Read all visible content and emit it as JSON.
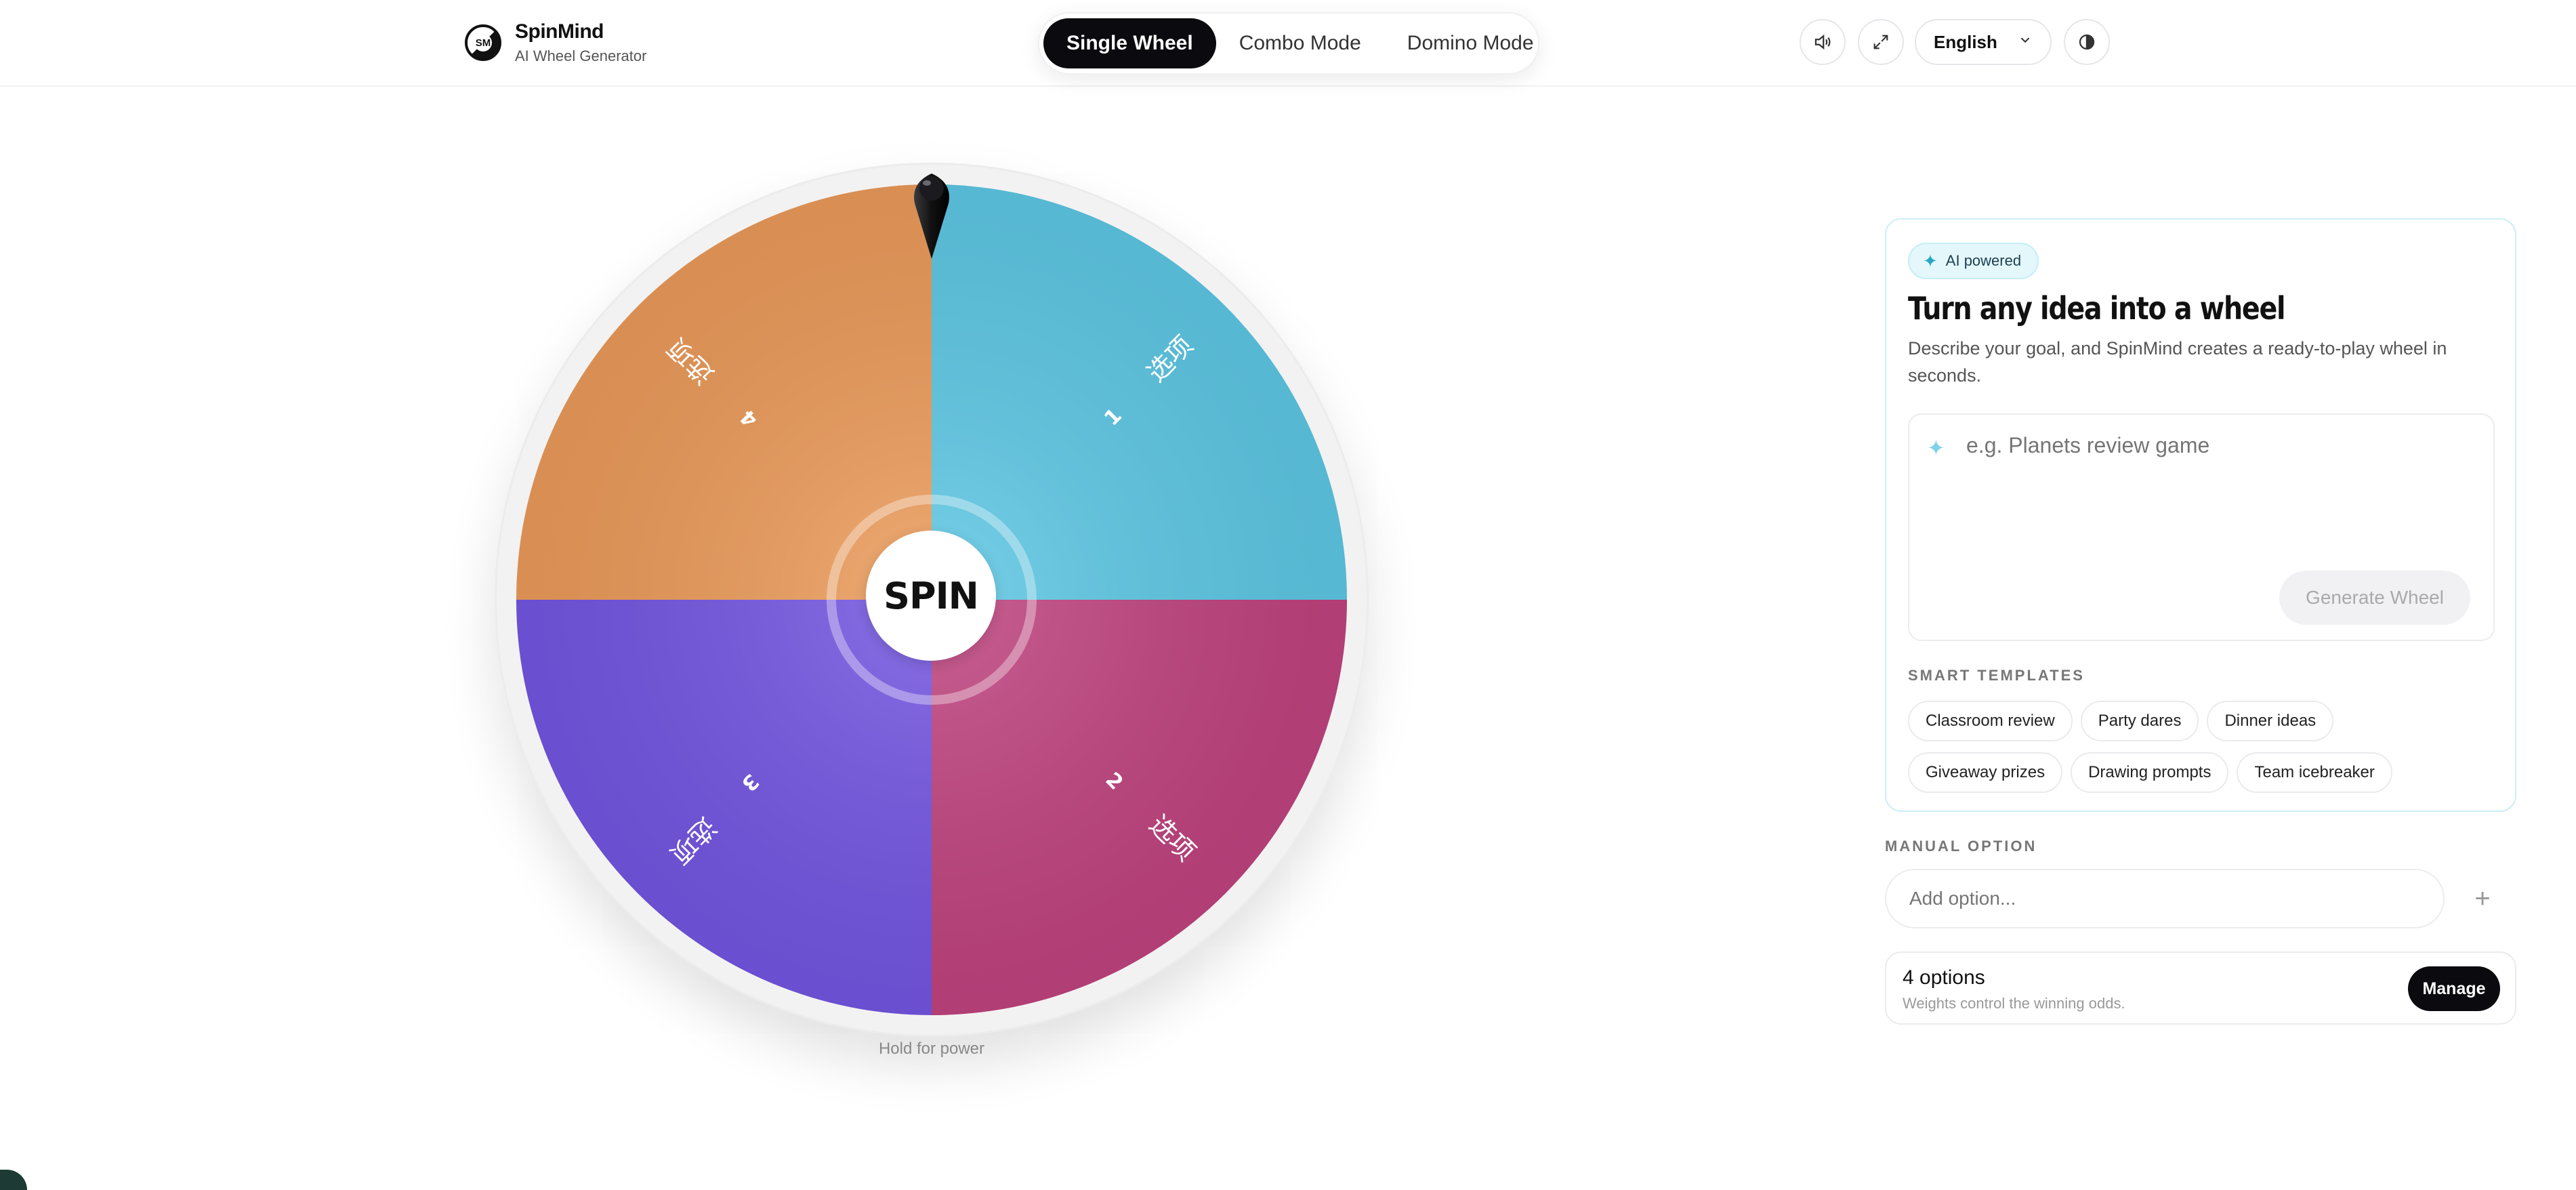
{
  "header": {
    "brand_name": "SpinMind",
    "brand_sub": "AI Wheel Generator",
    "logo_text": "SM",
    "modes": [
      {
        "label": "Single Wheel",
        "active": true
      },
      {
        "label": "Combo Mode",
        "active": false
      },
      {
        "label": "Domino Mode",
        "active": false
      }
    ],
    "language": "English",
    "icons": [
      "volume-icon",
      "fullscreen-icon",
      "chevron-down-icon",
      "theme-icon"
    ]
  },
  "wheel": {
    "spin_label": "SPIN",
    "hold_label": "Hold for power",
    "segments": [
      {
        "number": "1",
        "label": "选项",
        "color": "#5ec8e5"
      },
      {
        "number": "2",
        "label": "选项",
        "color": "#c0437f"
      },
      {
        "number": "3",
        "label": "选项",
        "color": "#7356e2"
      },
      {
        "number": "4",
        "label": "选项",
        "color": "#ec9b5a"
      }
    ]
  },
  "ai_card": {
    "badge": "AI powered",
    "title": "Turn any idea into a wheel",
    "description": "Describe your goal, and SpinMind creates a ready-to-play wheel in seconds.",
    "prompt_placeholder": "e.g. Planets review game",
    "generate_label": "Generate Wheel",
    "templates_label": "SMART TEMPLATES",
    "templates": [
      "Classroom review",
      "Party dares",
      "Dinner ideas",
      "Giveaway prizes",
      "Drawing prompts",
      "Team icebreaker"
    ]
  },
  "manual": {
    "label": "MANUAL OPTION",
    "placeholder": "Add option...",
    "add_symbol": "+"
  },
  "options_summary": {
    "count_text": "4 options",
    "subtext": "Weights control the winning odds.",
    "manage_label": "Manage"
  },
  "colors": {
    "accent_dark": "#0a0a0f",
    "ai_accent": "#27a6c8"
  }
}
